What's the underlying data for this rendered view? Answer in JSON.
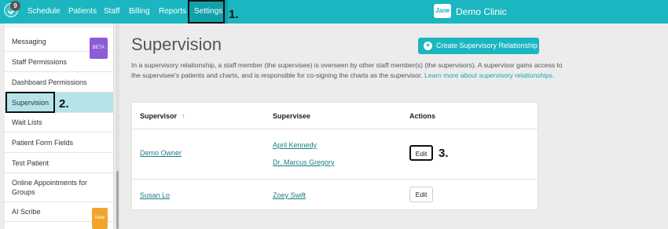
{
  "app": {
    "notification_count": "9",
    "clinic_name": "Demo Clinic",
    "clinic_logo_text": "Jane"
  },
  "nav": {
    "items": [
      {
        "label": "Schedule"
      },
      {
        "label": "Patients"
      },
      {
        "label": "Staff"
      },
      {
        "label": "Billing"
      },
      {
        "label": "Reports"
      },
      {
        "label": "Settings",
        "active": true
      }
    ]
  },
  "steps": {
    "one": "1.",
    "two": "2.",
    "three": "3."
  },
  "sidebar": {
    "items": [
      {
        "label": "Messaging",
        "badge": "BETA"
      },
      {
        "label": "Staff Permissions"
      },
      {
        "label": "Dashboard Permissions"
      },
      {
        "label": "Supervision",
        "active": true
      },
      {
        "label": "Wait Lists"
      },
      {
        "label": "Patient Form Fields"
      },
      {
        "label": "Test Patient"
      },
      {
        "label": "Online Appointments for Groups"
      },
      {
        "label": "AI Scribe",
        "badge": "New"
      }
    ]
  },
  "main": {
    "title": "Supervision",
    "create_button": "Create Supervisory Relationship",
    "description": "In a supervisory relationship, a staff member (the supervisee) is overseen by other staff member(s) (the supervisors). A supervisor gains access to the supervisee's patients and charts, and is responsible for co-signing the charts as the supervisor.",
    "learn_more": "Learn more about supervisory relationships.",
    "table": {
      "headers": {
        "supervisor": "Supervisor",
        "supervisee": "Supervisee",
        "actions": "Actions"
      },
      "rows": [
        {
          "supervisor": "Demo Owner",
          "supervisees": [
            "April Kennedy",
            "Dr. Marcus Gregory"
          ],
          "action": "Edit"
        },
        {
          "supervisor": "Susan Lo",
          "supervisees": [
            "Zoey Swift"
          ],
          "action": "Edit"
        }
      ]
    }
  },
  "colors": {
    "brand": "#1bb6bf",
    "active_sidebar": "#b5e4e8",
    "beta_badge": "#8a5cd6",
    "new_badge": "#f0a52a"
  }
}
